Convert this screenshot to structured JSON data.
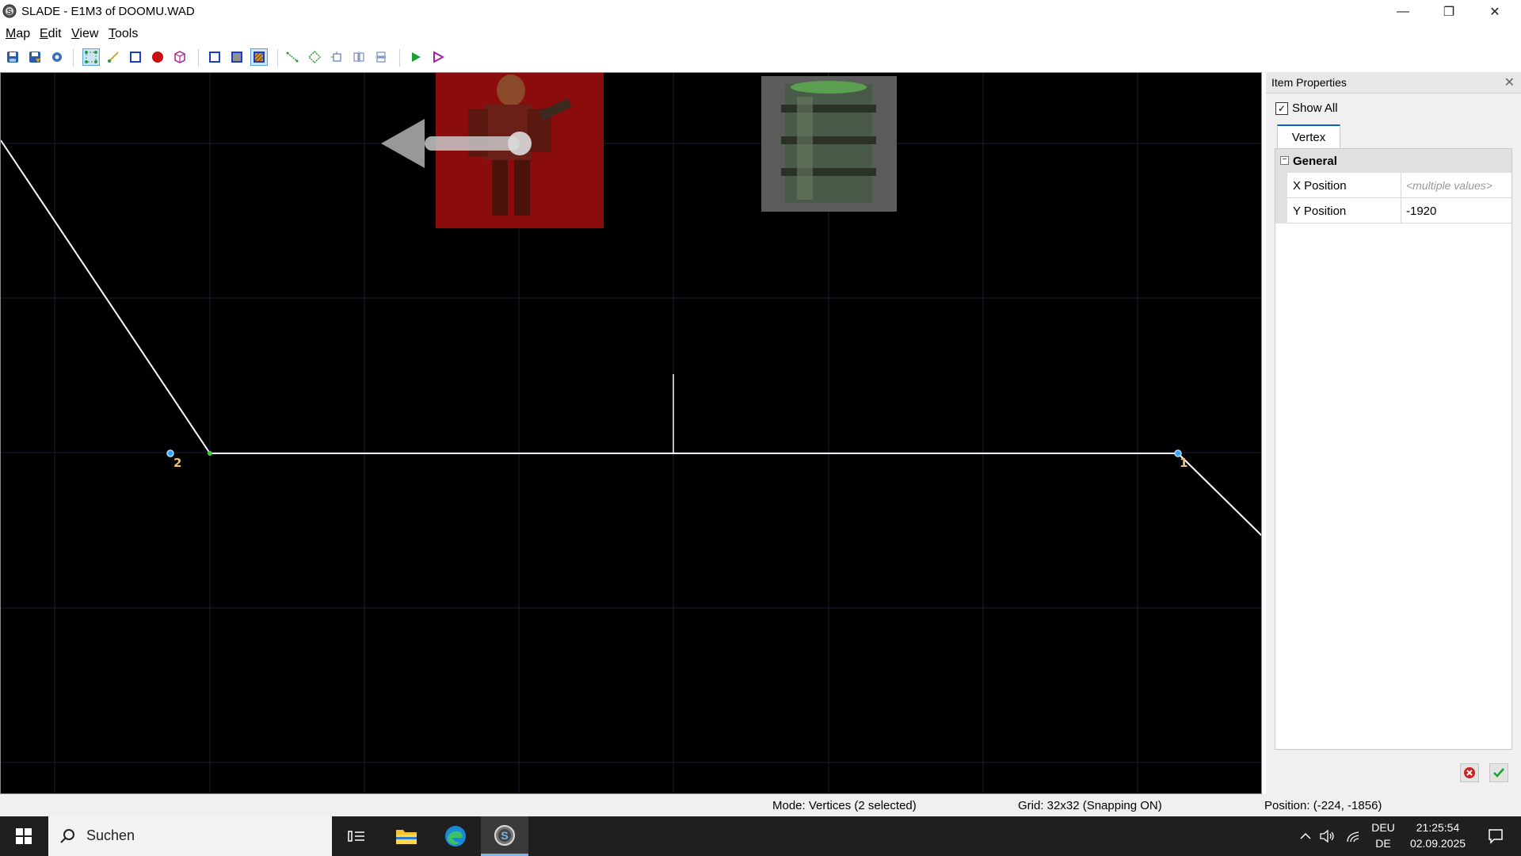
{
  "window": {
    "title": "SLADE - E1M3 of DOOMU.WAD",
    "minimize": "—",
    "maximize": "❐",
    "close": "✕"
  },
  "menu": {
    "items": [
      "Map",
      "Edit",
      "View",
      "Tools"
    ],
    "underline": [
      "M",
      "E",
      "V",
      "T"
    ],
    "rest": [
      "ap",
      "dit",
      "iew",
      "ools"
    ]
  },
  "props": {
    "title": "Item Properties",
    "show_all_label": "Show All",
    "show_all_checked": true,
    "tab_label": "Vertex",
    "category": "General",
    "rows": [
      {
        "name": "X Position",
        "value": "<multiple values>"
      },
      {
        "name": "Y Position",
        "value": "-1920"
      }
    ]
  },
  "map": {
    "vertex_labels": [
      "2",
      "1"
    ],
    "line_color": "#ffffff",
    "vertex_color": "#3aa0ff"
  },
  "status": {
    "mode": "Mode: Vertices (2 selected)",
    "grid": "Grid: 32x32 (Snapping ON)",
    "position": "Position: (-224, -1856)"
  },
  "taskbar": {
    "search_placeholder": "Suchen",
    "lang_top": "DEU",
    "lang_bottom": "DE",
    "time": "21:25:54",
    "date": "02.09.2025"
  }
}
